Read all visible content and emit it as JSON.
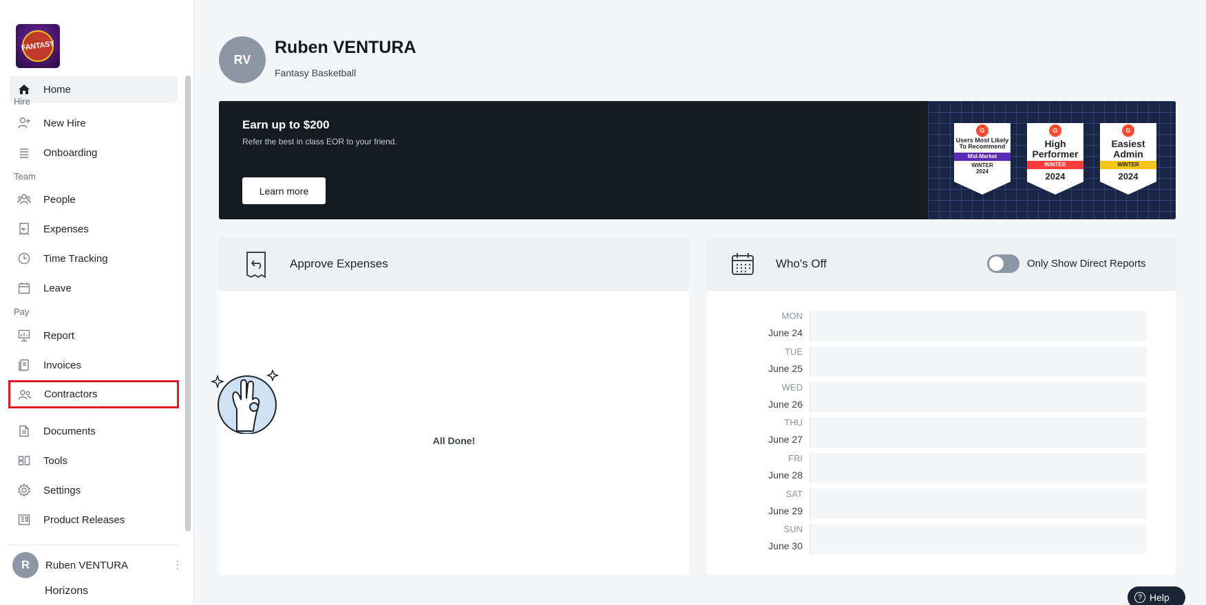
{
  "sidebar": {
    "logo_text": "FANTASY",
    "sections": {
      "hire": "Hire",
      "team": "Team",
      "pay": "Pay"
    },
    "items": [
      {
        "label": "Home",
        "icon": "home-icon"
      },
      {
        "label": "New Hire",
        "icon": "user-plus-icon"
      },
      {
        "label": "Onboarding",
        "icon": "list-icon"
      },
      {
        "label": "People",
        "icon": "people-icon"
      },
      {
        "label": "Expenses",
        "icon": "receipt-icon"
      },
      {
        "label": "Time Tracking",
        "icon": "clock-icon"
      },
      {
        "label": "Leave",
        "icon": "calendar-icon"
      },
      {
        "label": "Report",
        "icon": "chart-icon"
      },
      {
        "label": "Invoices",
        "icon": "invoice-icon"
      },
      {
        "label": "Contractors",
        "icon": "contractors-icon"
      },
      {
        "label": "Documents",
        "icon": "document-icon"
      },
      {
        "label": "Tools",
        "icon": "tools-icon"
      },
      {
        "label": "Settings",
        "icon": "gear-icon"
      },
      {
        "label": "Product Releases",
        "icon": "releases-icon"
      }
    ],
    "user": {
      "initial": "R",
      "name": "Ruben VENTURA",
      "org": "Horizons"
    }
  },
  "header": {
    "initials": "RV",
    "name": "Ruben VENTURA",
    "company": "Fantasy Basketball"
  },
  "banner": {
    "title": "Earn up to $200",
    "subtitle": "Refer the best in class EOR to your friend.",
    "button": "Learn more",
    "badges": [
      {
        "g2": "G",
        "title": "Users Most Likely To Recommend",
        "ribbon": "Mid-Market",
        "season": "WINTER",
        "year": "2024",
        "ribbon_color": "#5b2bb5"
      },
      {
        "g2": "G",
        "title": "High Performer",
        "ribbon": "WINTER",
        "season": "",
        "year": "2024",
        "ribbon_color": "#ff3b3b"
      },
      {
        "g2": "G",
        "title": "Easiest Admin",
        "ribbon": "WINTER",
        "season": "",
        "year": "2024",
        "ribbon_color": "#f5c518"
      }
    ]
  },
  "expenses_card": {
    "title": "Approve Expenses",
    "empty_text": "All Done!"
  },
  "whos_off_card": {
    "title": "Who's Off",
    "toggle_label": "Only Show Direct Reports",
    "toggle_on": false,
    "days": [
      {
        "dow": "MON",
        "date": "June 24"
      },
      {
        "dow": "TUE",
        "date": "June 25"
      },
      {
        "dow": "WED",
        "date": "June 26"
      },
      {
        "dow": "THU",
        "date": "June 27"
      },
      {
        "dow": "FRI",
        "date": "June 28"
      },
      {
        "dow": "SAT",
        "date": "June 29"
      },
      {
        "dow": "SUN",
        "date": "June 30"
      }
    ]
  },
  "help": {
    "label": "Help",
    "icon": "question-icon"
  }
}
